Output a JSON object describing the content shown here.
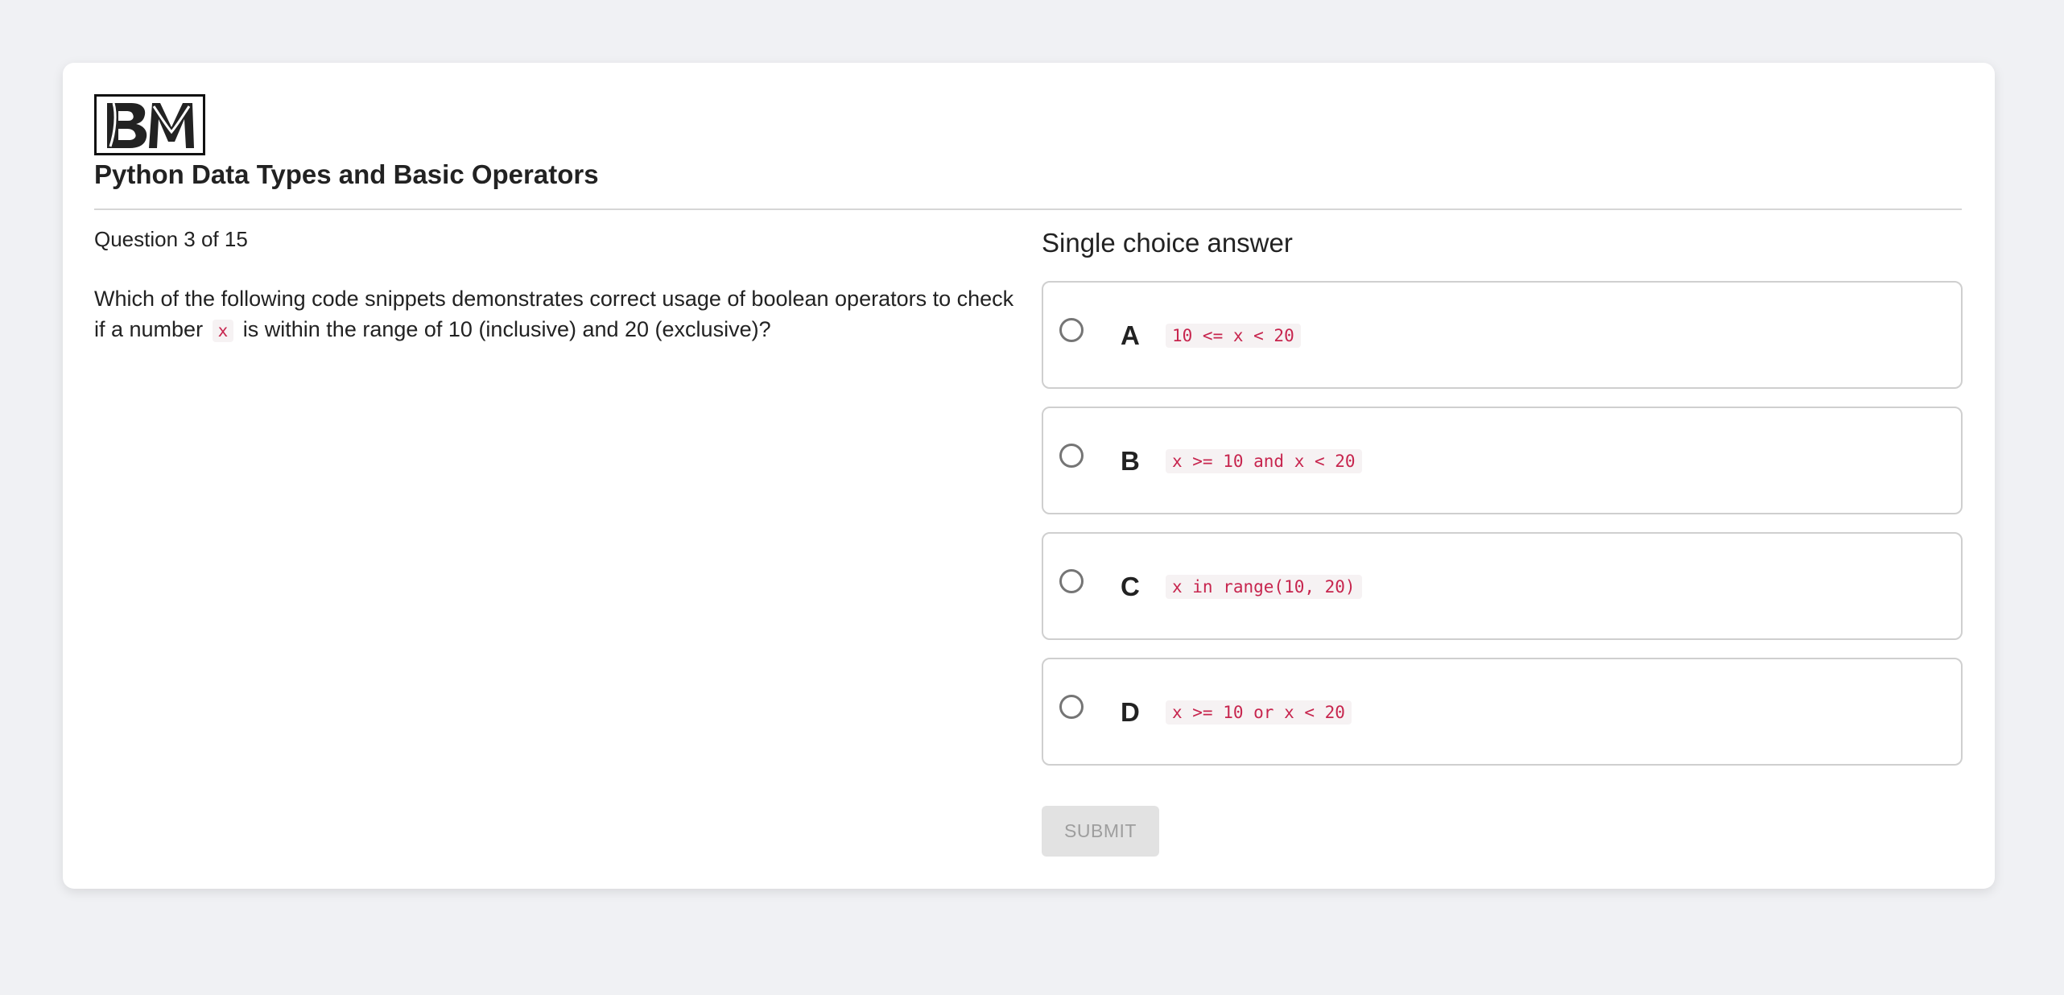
{
  "quiz": {
    "title": "Python Data Types and Basic Operators",
    "counter": "Question 3 of 15",
    "question_before": "Which of the following code snippets demonstrates correct usage of boolean operators to check if a number",
    "question_code": "x",
    "question_after": "is within the range of 10 (inclusive) and 20 (exclusive)?"
  },
  "answers": {
    "heading": "Single choice answer",
    "options": [
      {
        "letter": "A",
        "code": "10 <= x < 20"
      },
      {
        "letter": "B",
        "code": "x >= 10 and x < 20"
      },
      {
        "letter": "C",
        "code": "x in range(10, 20)"
      },
      {
        "letter": "D",
        "code": "x >= 10 or x < 20"
      }
    ]
  },
  "submit": {
    "label": "SUBMIT",
    "enabled": false
  },
  "colors": {
    "page_background": "#f0f1f4",
    "code_text": "#c7254e",
    "code_background": "#f6f2f3",
    "disabled_button": "#e2e2e2"
  },
  "logo": {
    "icon": "bm-logo",
    "text": "BM"
  }
}
